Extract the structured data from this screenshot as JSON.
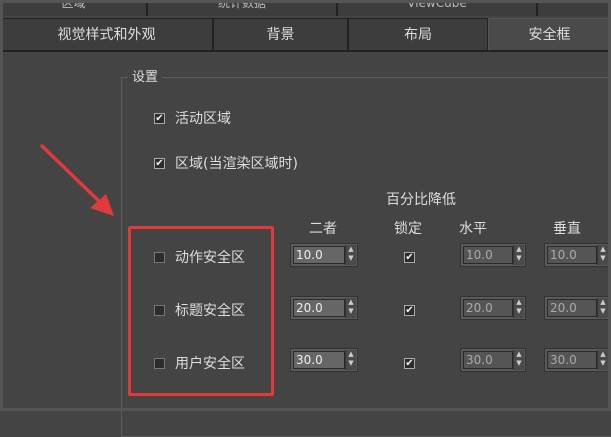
{
  "tabs_row1": [
    "区域",
    "统计数据",
    "ViewCube"
  ],
  "tabs_row2": [
    "视觉样式和外观",
    "背景",
    "布局",
    "安全框"
  ],
  "group": {
    "title": "设置",
    "live_area": {
      "label": "活动区域",
      "checked": true
    },
    "region": {
      "label": "区域(当渲染区域时)",
      "checked": true
    },
    "percent_header": "百分比降低",
    "col_both": "二者",
    "col_lock": "锁定",
    "col_horizontal": "水平",
    "col_vertical": "垂直",
    "rows": [
      {
        "label": "动作安全区",
        "checked": false,
        "both": "10.0",
        "locked": true,
        "h": "10.0",
        "v": "10.0"
      },
      {
        "label": "标题安全区",
        "checked": false,
        "both": "20.0",
        "locked": true,
        "h": "20.0",
        "v": "20.0"
      },
      {
        "label": "用户安全区",
        "checked": false,
        "both": "30.0",
        "locked": true,
        "h": "30.0",
        "v": "30.0"
      }
    ]
  },
  "colors": {
    "highlight_box": "#e03a3a",
    "arrow": "#e03a3a"
  },
  "icons": {
    "check": "check-icon",
    "spinner": "spinner-arrows-icon",
    "arrow": "annotation-arrow-icon"
  }
}
